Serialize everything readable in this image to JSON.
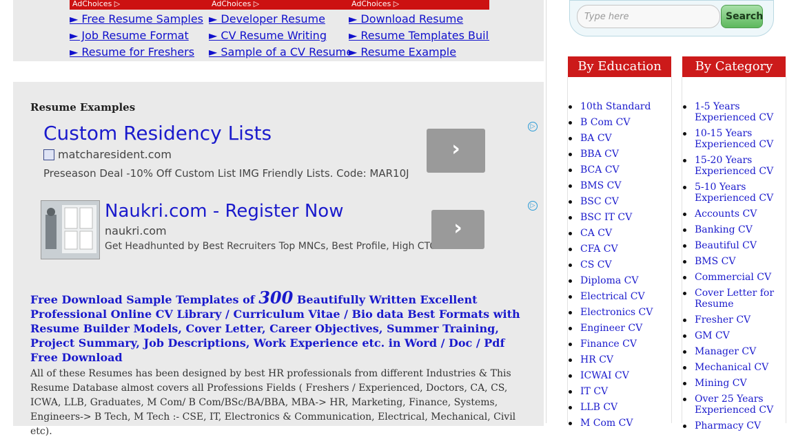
{
  "ad_links": {
    "adchoices_label": "AdChoices ▷",
    "columns": [
      [
        "► Free Resume Samples",
        "► Job Resume Format",
        "► Resume for Freshers"
      ],
      [
        "► Developer Resume",
        "► CV Resume Writing",
        "► Sample of a CV Resume"
      ],
      [
        "► Download Resume",
        "► Resume Templates Builder",
        "► Resume Example"
      ]
    ]
  },
  "section_title": "Resume Examples",
  "ads": [
    {
      "headline": "Custom Residency Lists",
      "domain": "matcharesident.com",
      "description": "Preseason Deal -10% Off Custom List IMG Friendly Lists. Code: MAR10J",
      "arrow": "›"
    },
    {
      "headline": "Naukri.com - Register Now",
      "domain": "naukri.com",
      "description": "Get Headhunted by Best Recruiters Top MNCs, Best Profile, High CTC",
      "arrow": "›"
    }
  ],
  "promo": {
    "part1": "Free Download Sample Templates of ",
    "number": "300",
    "part2": " Beautifully Written  Excellent Professional Online CV Library / Curriculum Vitae / Bio data Best Formats with Resume Builder Models, Cover Letter, Career Objectives, Summer Training, Project Summary, Job Descriptions, Work Experience etc. in Word / Doc / Pdf Free Download"
  },
  "intro_text": "All of these Resumes has been designed by best HR professionals from different Industries & This Resume Database almost covers all Professions Fields ( Freshers / Experienced, Doctors, CA, CS, ICWA, LLB, Graduates, M Com/ B Com/BSc/BA/BBA, MBA-> HR, Marketing, Finance, Systems, Engineers-> B Tech, M Tech :- CSE, IT, Electronics & Communication, Electrical, Mechanical, Civil etc).",
  "search": {
    "placeholder": "Type here",
    "button_label": "Search"
  },
  "by_education": {
    "title": "By Education",
    "items": [
      "10th Standard",
      "B Com CV",
      "BA CV",
      "BBA CV",
      "BCA CV",
      "BMS CV",
      "BSC CV",
      "BSC IT CV",
      "CA CV",
      "CFA CV",
      "CS CV",
      "Diploma CV",
      "Electrical CV",
      "Electronics CV",
      "Engineer CV",
      "Finance CV",
      "HR CV",
      "ICWAI CV",
      "IT CV",
      "LLB CV",
      "M Com CV"
    ]
  },
  "by_category": {
    "title": "By Category",
    "items": [
      "1-5 Years Experienced CV",
      "10-15 Years Experienced CV",
      "15-20 Years Experienced CV",
      "5-10 Years Experienced CV",
      "Accounts CV",
      "Banking CV",
      "Beautiful CV",
      "BMS CV",
      "Commercial CV",
      "Cover Letter for Resume",
      "Fresher CV",
      "GM CV",
      "Manager CV",
      "Mechanical CV",
      "Mining CV",
      "Over 25 Years Experienced CV",
      "Pharmacy CV"
    ]
  },
  "colors": {
    "accent_red": "#cc1a1a",
    "link_blue": "#1a1acc",
    "panel_gray": "#eaeaea",
    "search_green": "#5db85d"
  }
}
